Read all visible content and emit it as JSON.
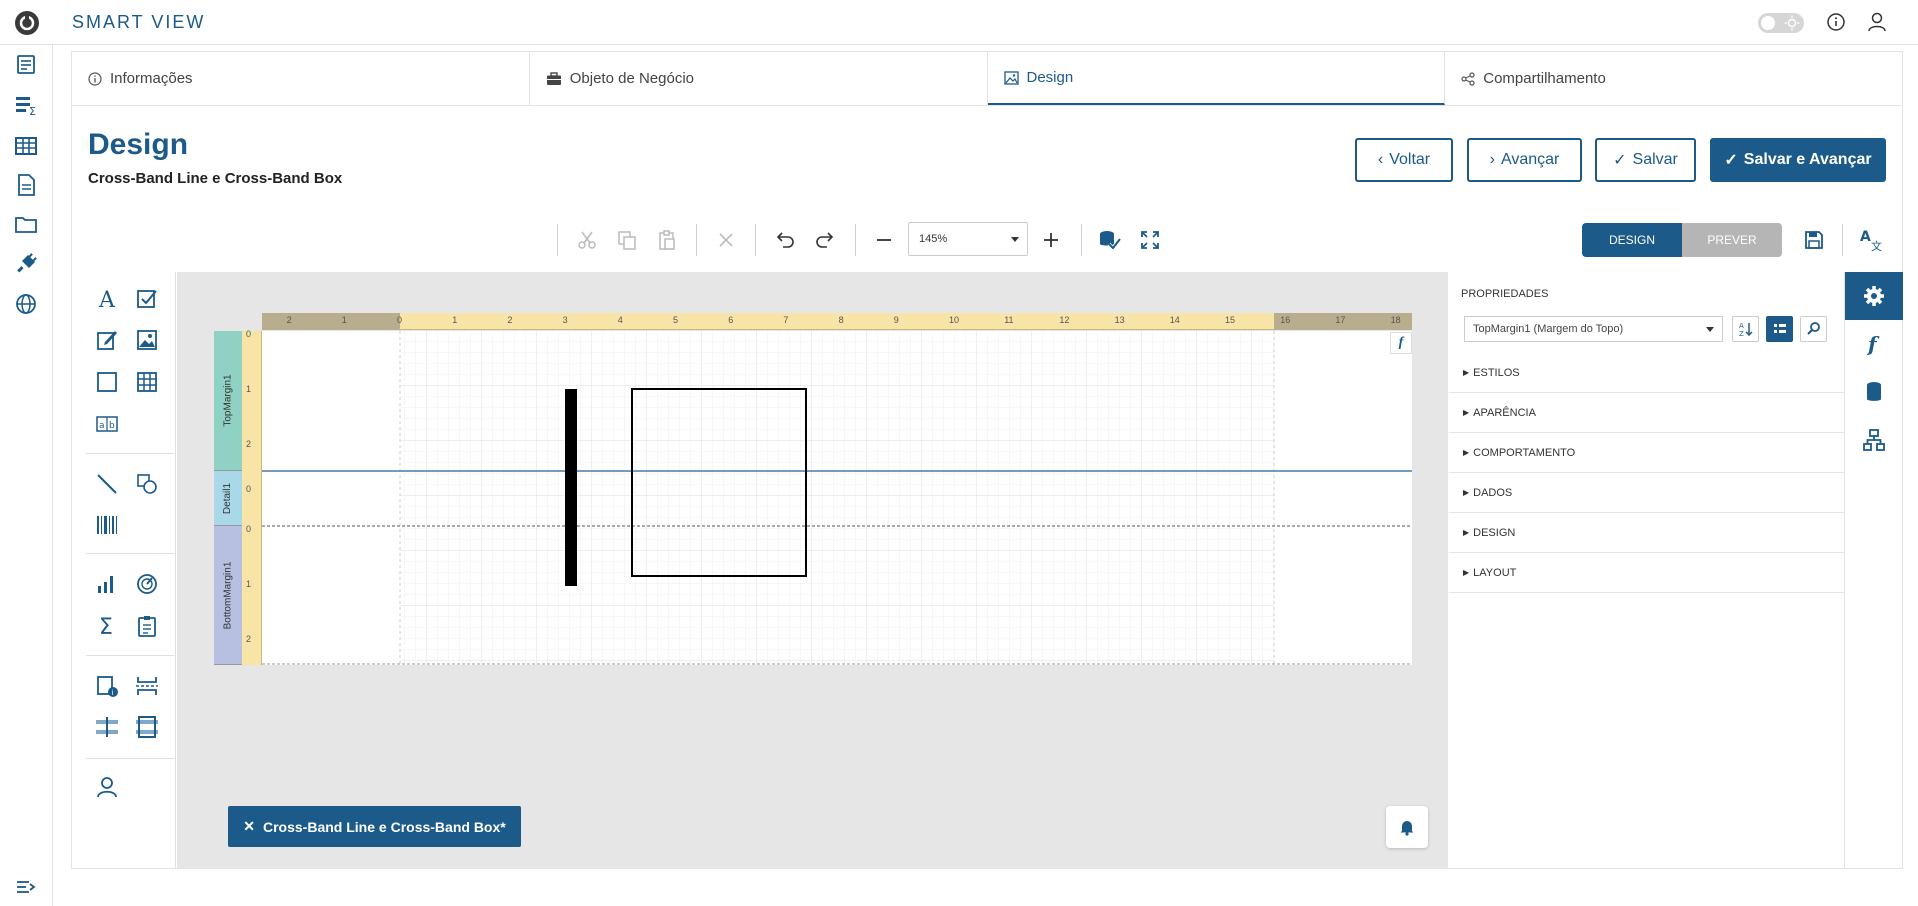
{
  "app": {
    "title": "SMART VIEW"
  },
  "tabs": [
    {
      "label": "Informações",
      "icon": "info-icon"
    },
    {
      "label": "Objeto de Negócio",
      "icon": "briefcase-icon"
    },
    {
      "label": "Design",
      "icon": "image-icon",
      "active": true
    },
    {
      "label": "Compartilhamento",
      "icon": "share-icon"
    }
  ],
  "page": {
    "title": "Design",
    "subtitle": "Cross-Band Line e Cross-Band Box"
  },
  "actions": {
    "back_label": "Voltar",
    "next_label": "Avançar",
    "save_label": "Salvar",
    "save_next_label": "Salvar e Avançar"
  },
  "toolbar": {
    "zoom": "145%",
    "mode_design": "DESIGN",
    "mode_preview": "PREVER"
  },
  "ruler": {
    "negative_labels": [
      "2",
      "1"
    ],
    "labels": [
      "0",
      "1",
      "2",
      "3",
      "4",
      "5",
      "6",
      "7",
      "8",
      "9",
      "10",
      "11",
      "12",
      "13",
      "14",
      "15",
      "16",
      "17",
      "18"
    ]
  },
  "bands": [
    {
      "label": "TopMargin1",
      "color": "#8fd1c3"
    },
    {
      "label": "Detail1",
      "color": "#a9d9e9"
    },
    {
      "label": "BottomMargin1",
      "color": "#b7c0e0"
    }
  ],
  "vertical_ruler": {
    "top": [
      "0",
      "1",
      "2"
    ],
    "detail": [
      "0"
    ],
    "bottom": [
      "0",
      "1",
      "2"
    ]
  },
  "report_tab": {
    "label": "Cross-Band Line e Cross-Band Box*"
  },
  "properties": {
    "title": "PROPRIEDADES",
    "selected": "TopMargin1 (Margem do Topo)",
    "sections": [
      "ESTILOS",
      "APARÊNCIA",
      "COMPORTAMENTO",
      "DADOS",
      "DESIGN",
      "LAYOUT"
    ]
  },
  "colors": {
    "primary": "#1c5a8a",
    "canvas": "#e6e6e6",
    "ruler": "#f7e4a6"
  }
}
